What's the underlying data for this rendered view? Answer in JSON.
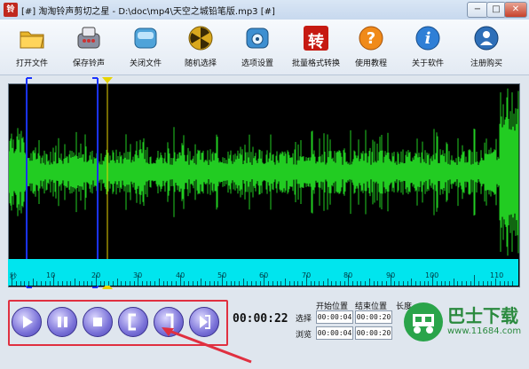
{
  "window": {
    "title": "[#] 淘淘铃声剪切之星 - D:\\doc\\mp4\\天空之城铅笔版.mp3 [#]",
    "app_icon_text": "铃",
    "minimize": "−",
    "maximize": "□",
    "close": "✕"
  },
  "toolbar": {
    "items": [
      {
        "label": "打开文件",
        "icon": "folder-icon"
      },
      {
        "label": "保存铃声",
        "icon": "save-ringtone-icon"
      },
      {
        "label": "关闭文件",
        "icon": "close-file-icon"
      },
      {
        "label": "随机选择",
        "icon": "random-icon"
      },
      {
        "label": "选项设置",
        "icon": "settings-icon"
      },
      {
        "label": "批量格式转换",
        "icon": "convert-icon",
        "glyph": "转"
      },
      {
        "label": "使用教程",
        "icon": "help-icon",
        "glyph": "?"
      },
      {
        "label": "关于软件",
        "icon": "about-icon",
        "glyph": "i"
      },
      {
        "label": "注册购买",
        "icon": "register-icon"
      }
    ]
  },
  "waveform": {
    "color": "#22cc22",
    "background": "#000000",
    "selection_start_seconds": 1,
    "selection_end_seconds": 21,
    "playhead_seconds": 23
  },
  "ruler": {
    "unit_label": "秒",
    "labels": [
      "10",
      "20",
      "30",
      "40",
      "50",
      "60",
      "70",
      "80",
      "90",
      "100",
      "110"
    ],
    "color": "#00e5ee"
  },
  "player": {
    "buttons": [
      "play-button",
      "pause-button",
      "stop-button",
      "mark-start-button",
      "mark-end-button",
      "play-selection-button"
    ],
    "current_time": "00:00:22"
  },
  "position_panel": {
    "col_start": "开始位置",
    "col_end": "结束位置",
    "col_length": "长度",
    "row_select": "选择",
    "row_browse": "浏览",
    "select_start": "00:00:04",
    "select_end": "00:00:20",
    "browse_start": "00:00:04",
    "browse_end": "00:00:20"
  },
  "watermark": {
    "text_cn": "巴士下载",
    "url": "www.11684.com"
  },
  "colors": {
    "highlight_box": "#e03040",
    "selection_marker": "#1a33ff",
    "playhead": "#e8d400"
  }
}
